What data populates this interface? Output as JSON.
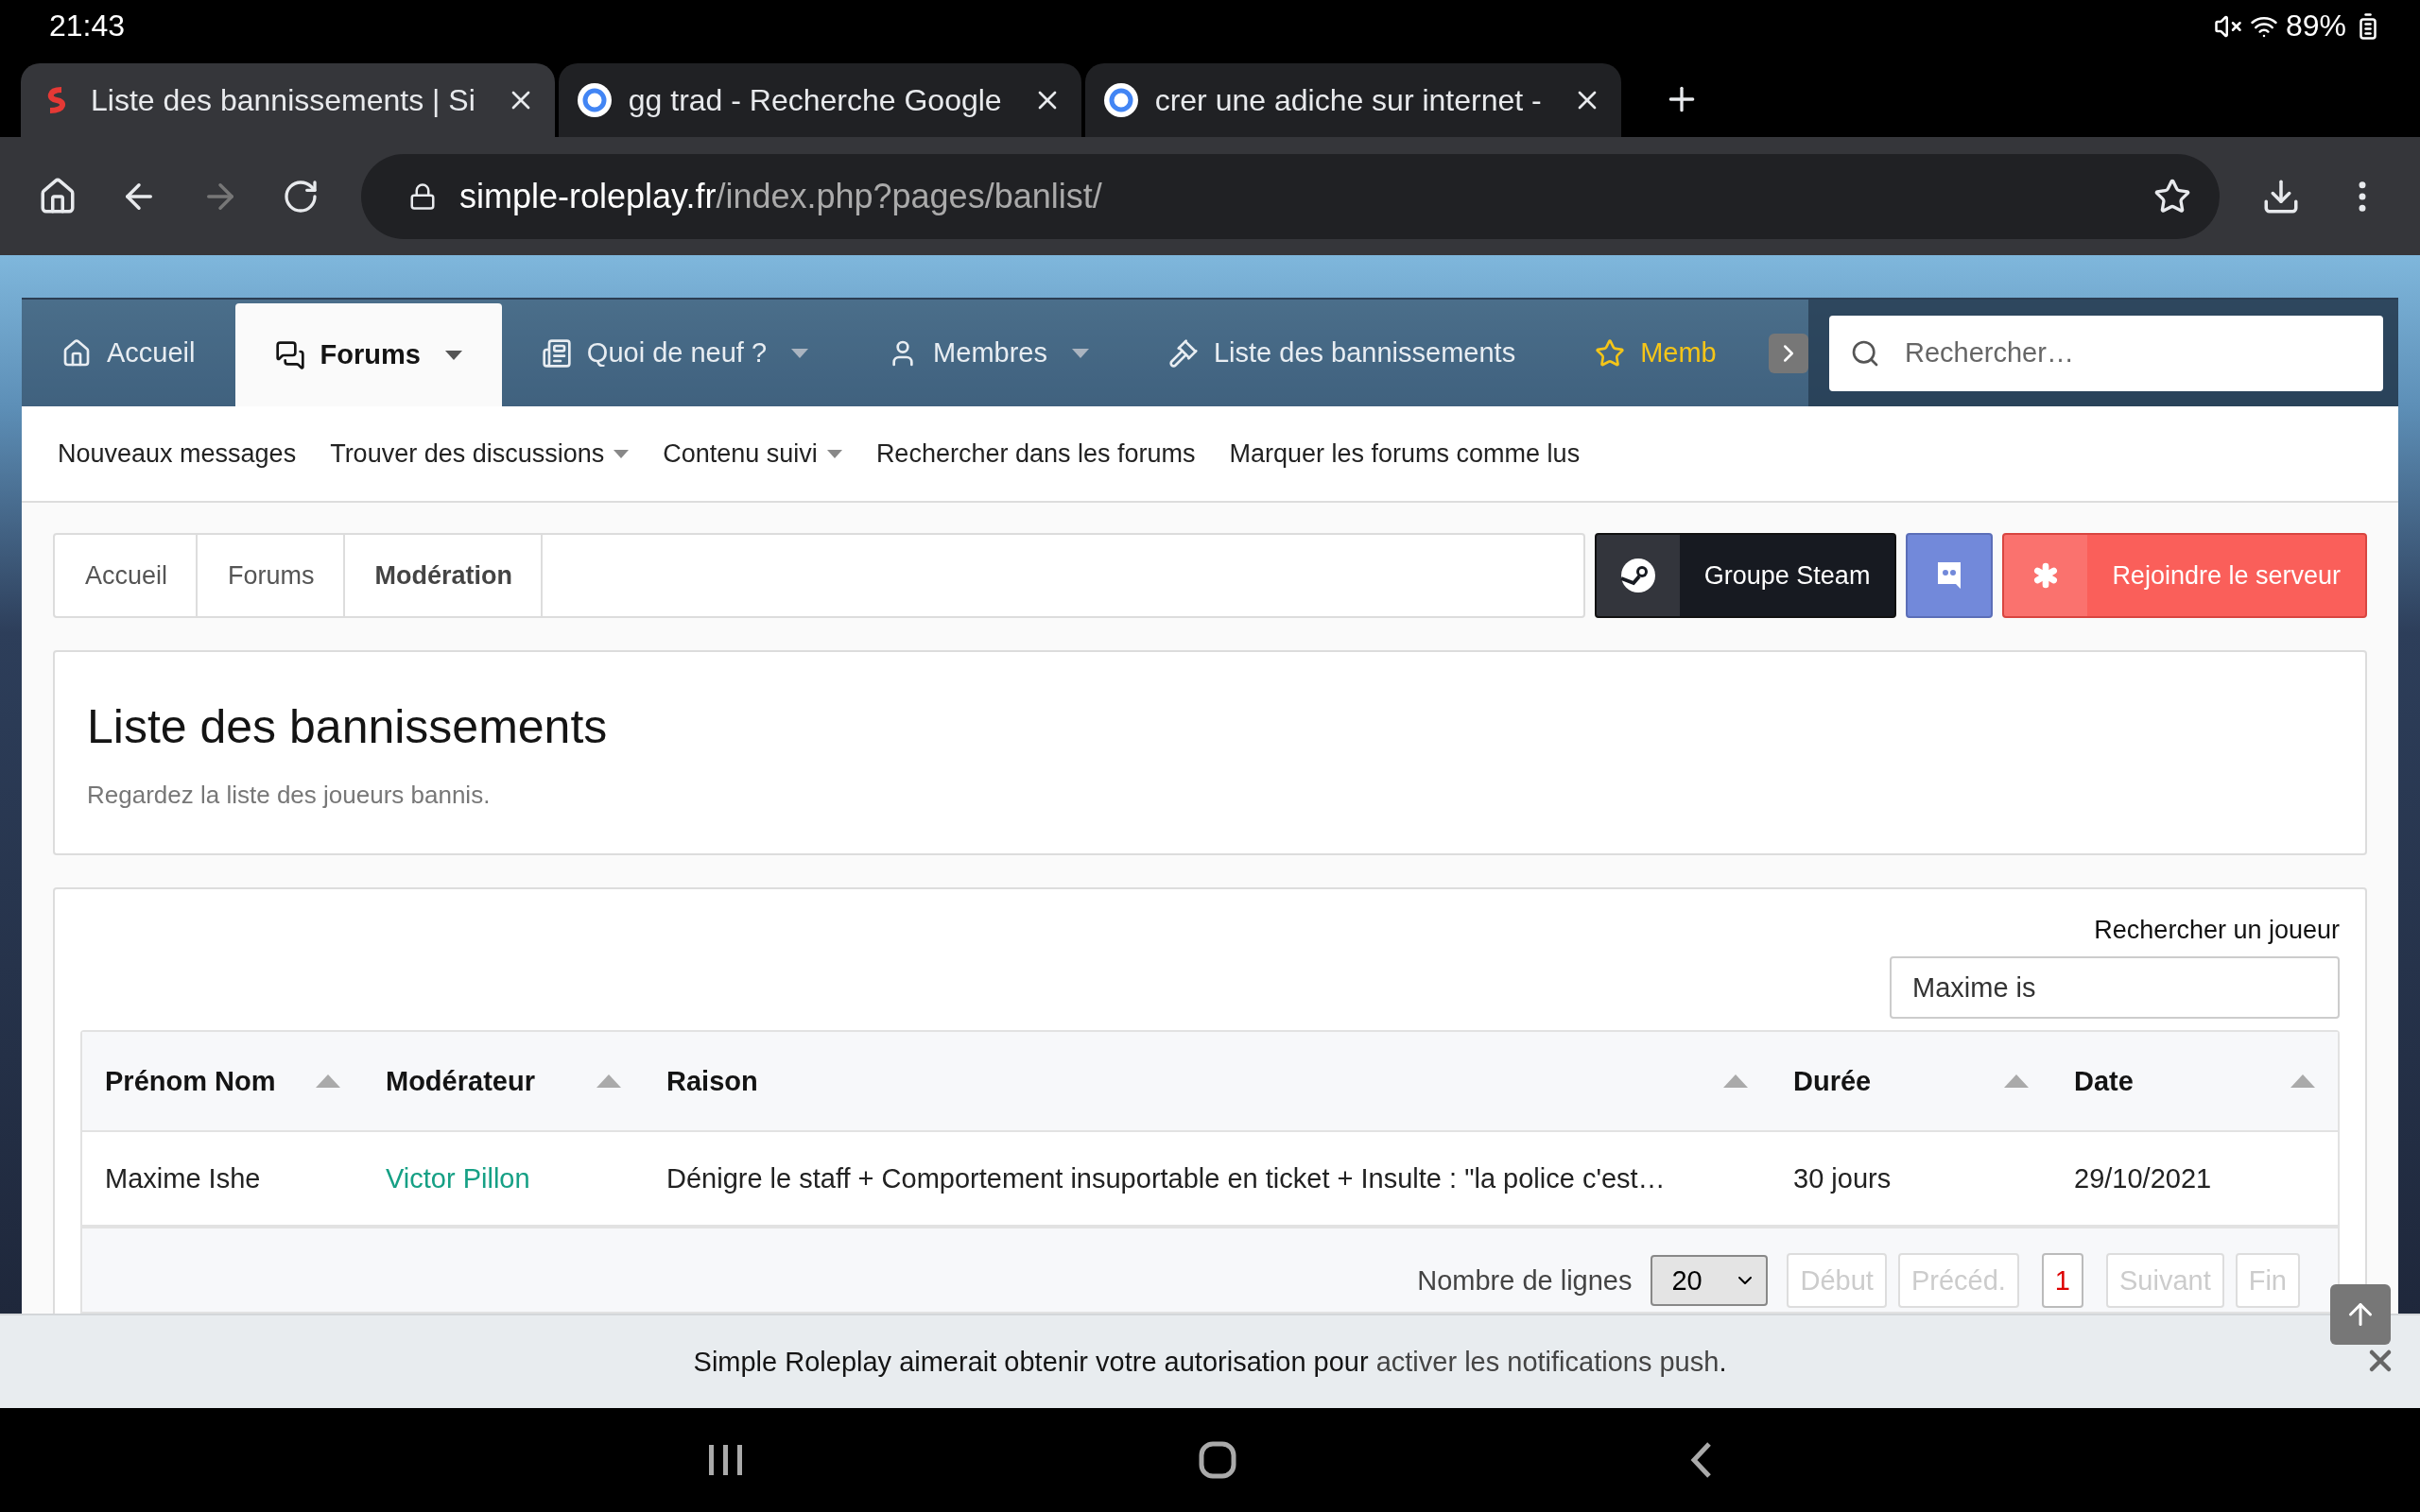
{
  "status_bar": {
    "time": "21:43",
    "battery": "89%"
  },
  "browser_tabs": [
    {
      "title": "Liste des bannissements | Si",
      "kind": "site",
      "selected": true
    },
    {
      "title": "gg trad - Recherche Google",
      "kind": "google",
      "selected": false
    },
    {
      "title": "crer une adiche sur internet -",
      "kind": "google",
      "selected": false
    }
  ],
  "address_bar": {
    "domain": "simple-roleplay.fr",
    "path": "/index.php?pages/banlist/"
  },
  "nav": {
    "items": [
      {
        "label": "Accueil",
        "selected": false,
        "dropdown": false,
        "highlight": false
      },
      {
        "label": "Forums",
        "selected": true,
        "dropdown": true,
        "highlight": false
      },
      {
        "label": "Quoi de neuf ?",
        "selected": false,
        "dropdown": true,
        "highlight": false
      },
      {
        "label": "Membres",
        "selected": false,
        "dropdown": true,
        "highlight": false
      },
      {
        "label": "Liste des bannissements",
        "selected": false,
        "dropdown": false,
        "highlight": false
      },
      {
        "label": "Memb",
        "selected": false,
        "dropdown": false,
        "highlight": true
      }
    ],
    "search_placeholder": "Rechercher…"
  },
  "subnav": [
    {
      "label": "Nouveaux messages",
      "dropdown": false
    },
    {
      "label": "Trouver des discussions",
      "dropdown": true
    },
    {
      "label": "Contenu suivi",
      "dropdown": true
    },
    {
      "label": "Rechercher dans les forums",
      "dropdown": false
    },
    {
      "label": "Marquer les forums comme lus",
      "dropdown": false
    }
  ],
  "breadcrumb": [
    {
      "label": "Accueil",
      "current": false
    },
    {
      "label": "Forums",
      "current": false
    },
    {
      "label": "Modération",
      "current": true
    }
  ],
  "social_buttons": [
    {
      "kind": "steam",
      "label": "Groupe Steam"
    },
    {
      "kind": "discord"
    },
    {
      "kind": "join",
      "label": "Rejoindre le serveur"
    }
  ],
  "header": {
    "title": "Liste des bannissements",
    "description": "Regardez la liste des joueurs bannis."
  },
  "player_search": {
    "label": "Rechercher un joueur",
    "value": "Maxime is"
  },
  "table": {
    "columns": [
      "Prénom Nom",
      "Modérateur",
      "Raison",
      "Durée",
      "Date"
    ],
    "rows": [
      {
        "name": "Maxime Ishe",
        "moderator": "Victor Pillon",
        "reason": "Dénigre le staff + Comportement insuportable en ticket + Insulte : \"la police c'est…",
        "duration": "30 jours",
        "date": "29/10/2021"
      }
    ]
  },
  "pagination": {
    "label": "Nombre de lignes",
    "rows_per_page": "20",
    "buttons": [
      {
        "label": "Début",
        "disabled": true,
        "selected": false
      },
      {
        "label": "Précéd.",
        "disabled": true,
        "selected": false
      },
      {
        "label": "1",
        "disabled": false,
        "selected": true
      },
      {
        "label": "Suivant",
        "disabled": true,
        "selected": false
      },
      {
        "label": "Fin",
        "disabled": true,
        "selected": false
      }
    ]
  },
  "notification": {
    "text": "Simple Roleplay aimerait obtenir votre autorisation pour ",
    "link": "activer les notifications push",
    "end": "."
  }
}
